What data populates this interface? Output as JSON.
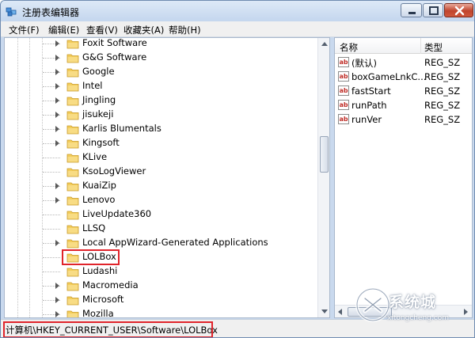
{
  "window": {
    "title": "注册表编辑器"
  },
  "menu": [
    {
      "label": "文件(F)"
    },
    {
      "label": "编辑(E)"
    },
    {
      "label": "查看(V)"
    },
    {
      "label": "收藏夹(A)"
    },
    {
      "label": "帮助(H)"
    }
  ],
  "tree": {
    "items": [
      {
        "label": "Foxit Software",
        "expandable": true
      },
      {
        "label": "G&G Software",
        "expandable": true
      },
      {
        "label": "Google",
        "expandable": true
      },
      {
        "label": "Intel",
        "expandable": true
      },
      {
        "label": "Jingling",
        "expandable": true
      },
      {
        "label": "jisukeji",
        "expandable": true
      },
      {
        "label": "Karlis Blumentals",
        "expandable": true
      },
      {
        "label": "Kingsoft",
        "expandable": true
      },
      {
        "label": "KLive",
        "expandable": false
      },
      {
        "label": "KsoLogViewer",
        "expandable": false
      },
      {
        "label": "KuaiZip",
        "expandable": true
      },
      {
        "label": "Lenovo",
        "expandable": true
      },
      {
        "label": "LiveUpdate360",
        "expandable": false
      },
      {
        "label": "LLSQ",
        "expandable": false
      },
      {
        "label": "Local AppWizard-Generated Applications",
        "expandable": true
      },
      {
        "label": "LOLBox",
        "expandable": false,
        "selected": true
      },
      {
        "label": "Ludashi",
        "expandable": false
      },
      {
        "label": "Macromedia",
        "expandable": true
      },
      {
        "label": "Microsoft",
        "expandable": true
      },
      {
        "label": "Mozilla",
        "expandable": true
      }
    ]
  },
  "list": {
    "columns": {
      "name": "名称",
      "type": "类型"
    },
    "rows": [
      {
        "name": "(默认)",
        "type": "REG_SZ",
        "icon": "string-value-icon"
      },
      {
        "name": "boxGameLnkC...",
        "type": "REG_SZ",
        "icon": "string-value-icon"
      },
      {
        "name": "fastStart",
        "type": "REG_SZ",
        "icon": "string-value-icon"
      },
      {
        "name": "runPath",
        "type": "REG_SZ",
        "icon": "string-value-icon"
      },
      {
        "name": "runVer",
        "type": "REG_SZ",
        "icon": "string-value-icon"
      }
    ],
    "icon_text": "ab"
  },
  "status": {
    "path": "计算机\\HKEY_CURRENT_USER\\Software\\LOLBox"
  },
  "watermark": {
    "text": "系统城",
    "sub": "xitongcheng.com"
  },
  "colors": {
    "highlight": "#e0242b",
    "folder": "#f3cd5a"
  }
}
